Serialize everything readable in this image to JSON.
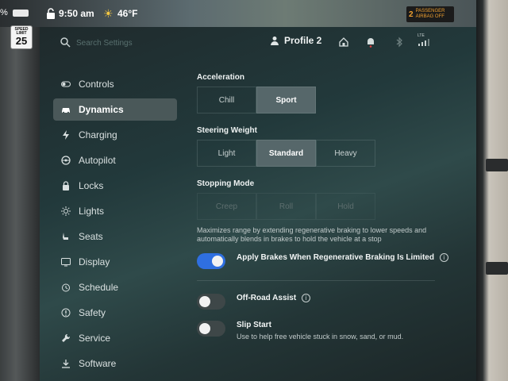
{
  "status_bar": {
    "battery_text": "%",
    "time": "9:50 am",
    "temperature": "46°F",
    "airbag_line1": "PASSENGER",
    "airbag_line2": "AIRBAG OFF",
    "airbag_badge": "2"
  },
  "speed_limit": {
    "label": "SPEED LIMIT",
    "value": "25"
  },
  "header": {
    "search_placeholder": "Search Settings",
    "profile_label": "Profile 2",
    "lte_label": "LTE"
  },
  "sidebar": {
    "items": [
      {
        "label": "Controls",
        "icon": "toggle-icon",
        "active": false
      },
      {
        "label": "Dynamics",
        "icon": "car-icon",
        "active": true
      },
      {
        "label": "Charging",
        "icon": "lightning-icon",
        "active": false
      },
      {
        "label": "Autopilot",
        "icon": "steering-wheel-icon",
        "active": false
      },
      {
        "label": "Locks",
        "icon": "lock-icon",
        "active": false
      },
      {
        "label": "Lights",
        "icon": "sun-icon",
        "active": false
      },
      {
        "label": "Seats",
        "icon": "seat-icon",
        "active": false
      },
      {
        "label": "Display",
        "icon": "display-icon",
        "active": false
      },
      {
        "label": "Schedule",
        "icon": "clock-icon",
        "active": false
      },
      {
        "label": "Safety",
        "icon": "alert-icon",
        "active": false
      },
      {
        "label": "Service",
        "icon": "wrench-icon",
        "active": false
      },
      {
        "label": "Software",
        "icon": "download-icon",
        "active": false
      }
    ]
  },
  "dynamics": {
    "acceleration": {
      "title": "Acceleration",
      "options": [
        "Chill",
        "Sport"
      ],
      "selected": "Sport"
    },
    "steering_weight": {
      "title": "Steering Weight",
      "options": [
        "Light",
        "Standard",
        "Heavy"
      ],
      "selected": "Standard"
    },
    "stopping_mode": {
      "title": "Stopping Mode",
      "options": [
        "Creep",
        "Roll",
        "Hold"
      ],
      "description": "Maximizes range by extending regenerative braking to lower speeds and automatically blends in brakes to hold the vehicle at a stop"
    },
    "apply_brakes": {
      "label": "Apply Brakes When Regenerative Braking Is Limited",
      "enabled": true
    },
    "off_road_assist": {
      "label": "Off-Road Assist",
      "enabled": false
    },
    "slip_start": {
      "label": "Slip Start",
      "description": "Use to help free vehicle stuck in snow, sand, or mud.",
      "enabled": false
    }
  },
  "colors": {
    "accent_blue": "#2f6fe0",
    "active_nav_bg": "#4a5859",
    "airbag_text": "#f0a030"
  }
}
